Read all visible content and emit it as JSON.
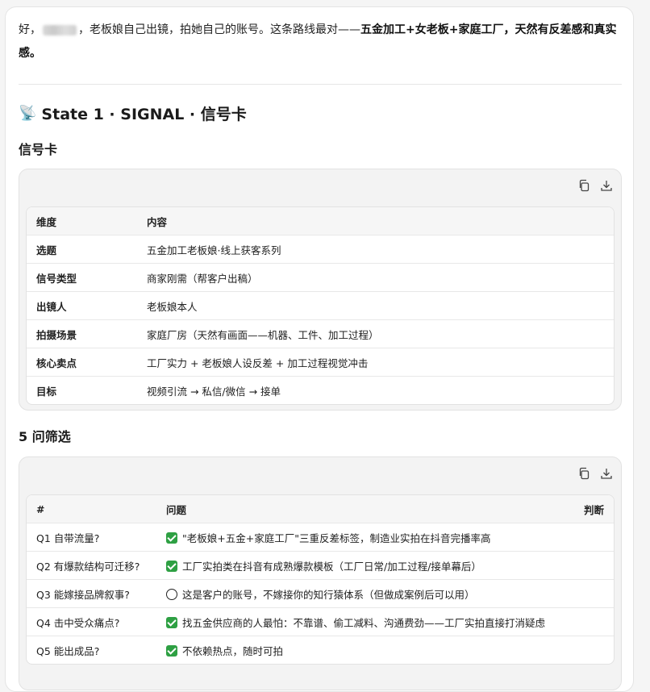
{
  "intro": {
    "prefix": "好，",
    "middle": "，老板娘自己出镜，拍她自己的账号。这条路线最对——",
    "bold": "五金加工+女老板+家庭工厂，天然有反差感和真实感。"
  },
  "section": {
    "emoji": "📡",
    "title": "State 1 · SIGNAL · 信号卡"
  },
  "signal_card": {
    "heading": "信号卡",
    "columns": [
      "维度",
      "内容"
    ],
    "rows": [
      [
        "选题",
        "五金加工老板娘·线上获客系列"
      ],
      [
        "信号类型",
        "商家刚需（帮客户出稿）"
      ],
      [
        "出镜人",
        "老板娘本人"
      ],
      [
        "拍摄场景",
        "家庭厂房（天然有画面——机器、工件、加工过程）"
      ],
      [
        "核心卖点",
        "工厂实力 + 老板娘人设反差 + 加工过程视觉冲击"
      ],
      [
        "目标",
        "视频引流 → 私信/微信 → 接单"
      ]
    ]
  },
  "five_questions": {
    "heading": "5 问筛选",
    "columns": [
      "#",
      "问题",
      "判断"
    ],
    "rows": [
      {
        "q": "Q1 自带流量?",
        "mark": "check",
        "a": "\"老板娘+五金+家庭工厂\"三重反差标签，制造业实拍在抖音完播率高"
      },
      {
        "q": "Q2 有爆款结构可迁移?",
        "mark": "check",
        "a": "工厂实拍类在抖音有成熟爆款模板（工厂日常/加工过程/接单幕后）"
      },
      {
        "q": "Q3 能嫁接品牌叙事?",
        "mark": "circle",
        "a": "这是客户的账号，不嫁接你的知行猿体系（但做成案例后可以用）"
      },
      {
        "q": "Q4 击中受众痛点?",
        "mark": "check",
        "a": "找五金供应商的人最怕：不靠谱、偷工减料、沟通费劲——工厂实拍直接打消疑虑"
      },
      {
        "q": "Q5 能出成品?",
        "mark": "check",
        "a": "不依赖热点，随时可拍"
      }
    ]
  },
  "icons": {
    "copy": "copy-icon",
    "download": "download-icon",
    "check": "check-mark-icon",
    "circle": "hollow-circle-icon"
  },
  "colors": {
    "check_green": "#2ea043",
    "block_bg": "#f3f3f3"
  }
}
